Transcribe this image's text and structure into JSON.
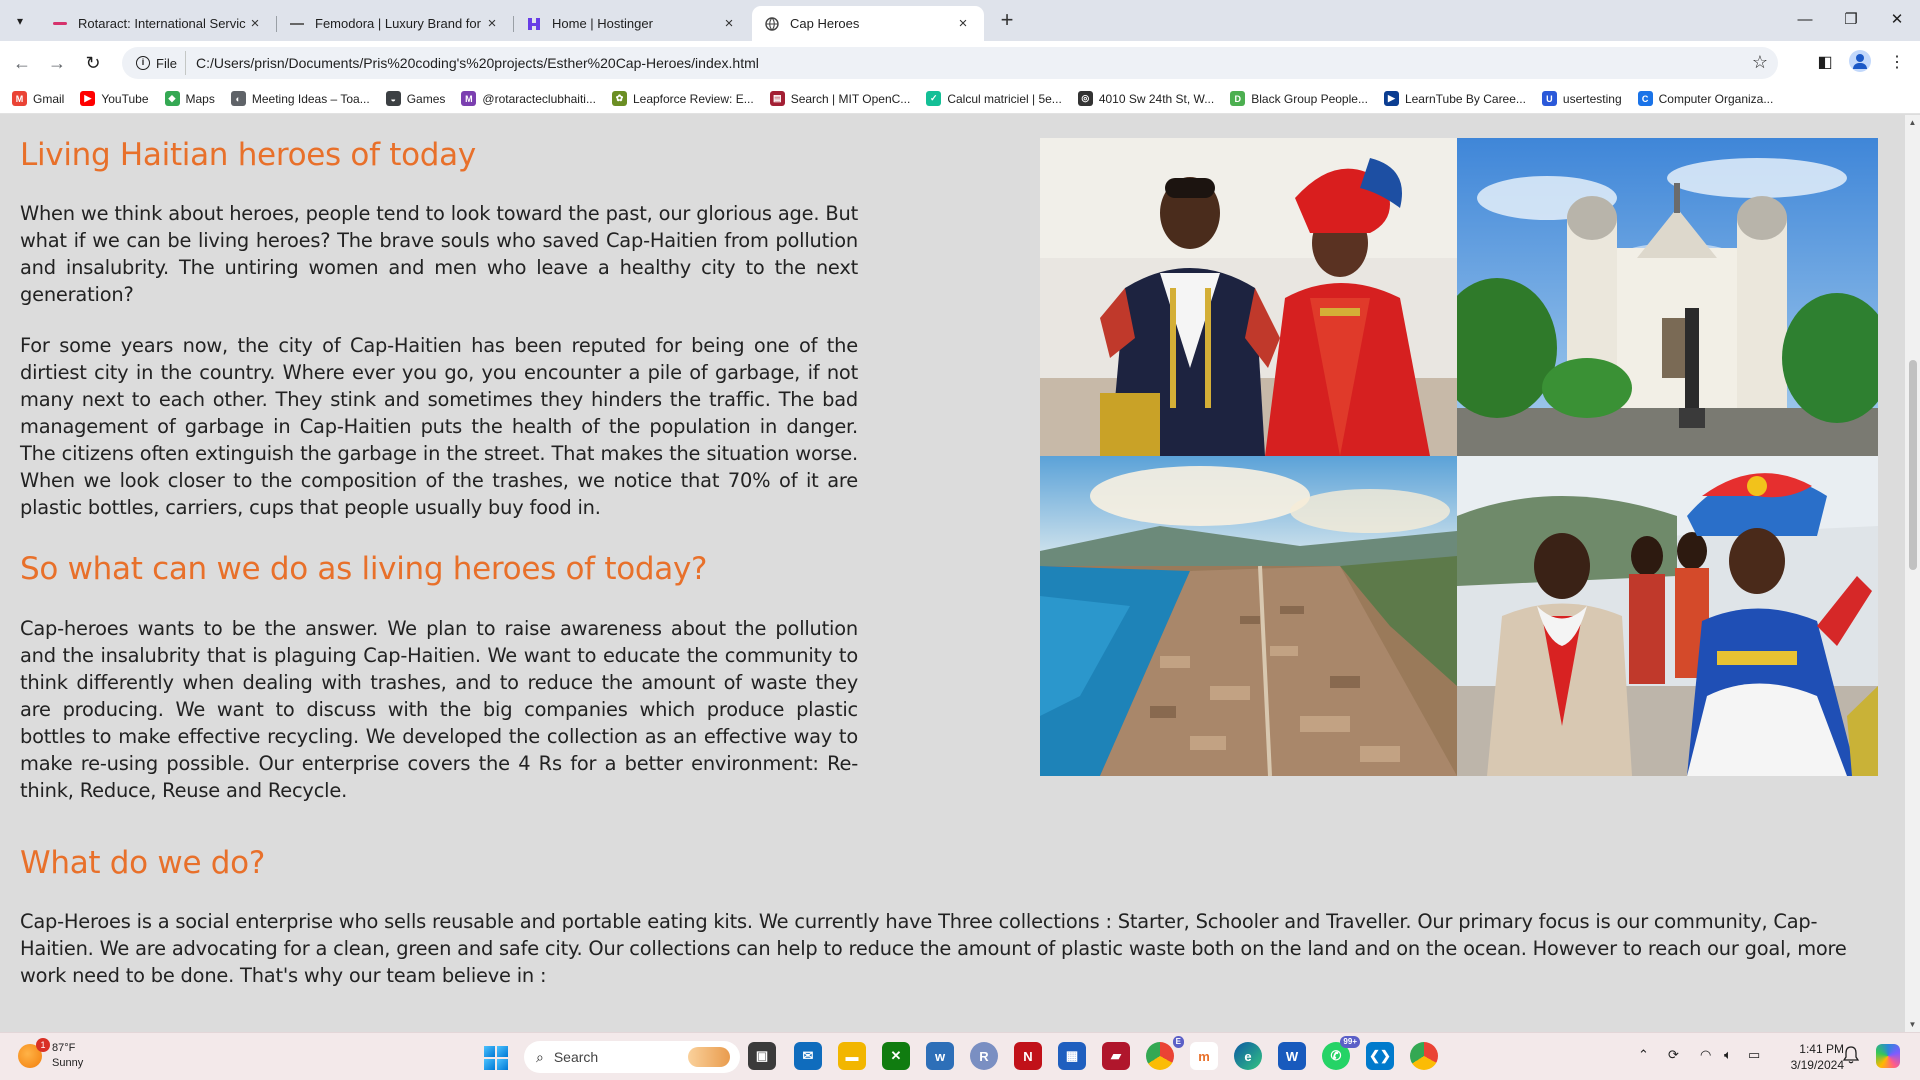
{
  "browser": {
    "tabs": [
      {
        "title": "Rotaract: International Service Cl",
        "icon": "rotaract-favicon"
      },
      {
        "title": "Femodora | Luxury Brand for Wo",
        "icon": "femodora-favicon"
      },
      {
        "title": "Home | Hostinger",
        "icon": "hostinger-favicon"
      },
      {
        "title": "Cap Heroes",
        "icon": "globe-favicon",
        "active": true
      }
    ],
    "omnibox": {
      "scheme_label": "File",
      "url": "C:/Users/prisn/Documents/Pris%20coding's%20projects/Esther%20Cap-Heroes/index.html"
    },
    "bookmarks": [
      {
        "label": "Gmail",
        "icon": "gmail-icon",
        "color": "#ea4335",
        "glyph": "M"
      },
      {
        "label": "YouTube",
        "icon": "youtube-icon",
        "color": "#ff0000",
        "glyph": "▶"
      },
      {
        "label": "Maps",
        "icon": "maps-icon",
        "color": "#34a853",
        "glyph": "◆"
      },
      {
        "label": "Meeting Ideas – Toa...",
        "icon": "globe-icon",
        "color": "#5f6368",
        "glyph": "◐"
      },
      {
        "label": "Games",
        "icon": "games-icon",
        "color": "#3c4043",
        "glyph": "◒"
      },
      {
        "label": "@rotaracteclubhaiti...",
        "icon": "rotaract-icon",
        "color": "#7b3fb0",
        "glyph": "M"
      },
      {
        "label": "Leapforce Review: E...",
        "icon": "leapforce-icon",
        "color": "#6b8e23",
        "glyph": "✿"
      },
      {
        "label": "Search | MIT OpenC...",
        "icon": "mit-icon",
        "color": "#a31f34",
        "glyph": "▤"
      },
      {
        "label": "Calcul matriciel | 5e...",
        "icon": "khan-icon",
        "color": "#14bf96",
        "glyph": "✓"
      },
      {
        "label": "4010 Sw 24th St, W...",
        "icon": "location-icon",
        "color": "#333333",
        "glyph": "◎"
      },
      {
        "label": "Black Group People...",
        "icon": "doc-icon",
        "color": "#4caf50",
        "glyph": "D"
      },
      {
        "label": "LearnTube By Caree...",
        "icon": "learntube-icon",
        "color": "#0b3d91",
        "glyph": "▶"
      },
      {
        "label": "usertesting",
        "icon": "usertesting-icon",
        "color": "#2b59d9",
        "glyph": "U"
      },
      {
        "label": "Computer Organiza...",
        "icon": "computer-org-icon",
        "color": "#1a73e8",
        "glyph": "C"
      }
    ]
  },
  "page": {
    "heading1": "Living Haitian heroes of today",
    "para1": "When we think about heroes, people tend to look toward the past, our glorious age. But what if we can be living heroes? The brave souls who saved Cap-Haitien from pollution and insalubrity. The untiring women and men who leave a healthy city to the next generation?",
    "para2": "For some years now, the city of Cap-Haitien has been reputed for being one of the dirtiest city in the country. Where ever you go, you encounter a pile of garbage, if not many next to each other. They stink and sometimes they hinders the traffic. The bad management of garbage in Cap-Haitien puts the health of the population in danger. The citizens often extinguish the garbage in the street. That makes the situation worse. When we look closer to the composition of the trashes, we notice that 70% of it are plastic bottles, carriers, cups that people usually buy food in.",
    "heading2": "So what can we do as living heroes of today?",
    "para3": "Cap-heroes wants to be the answer. We plan to raise awareness about the pollution and the insalubrity that is plaguing Cap-Haitien. We want to educate the community to think differently when dealing with trashes, and to reduce the amount of waste they are producing. We want to discuss with the big companies which produce plastic bottles to make effective recycling. We developed the collection as an effective way to make re-using possible. Our enterprise covers the 4 Rs for a better environment: Re-think, Reduce, Reuse and Recycle.",
    "heading3": "What do we do?",
    "para4": "Cap-Heroes is a social enterprise who sells reusable and portable eating kits. We currently have Three collections : Starter, Schooler and Traveller. Our primary focus is our community, Cap-Haitien. We are advocating for a clean, green and safe city. Our collections can help to reduce the amount of plastic waste both on the land and on the ocean. However to reach our goal, more work need to be done. That's why our team believe in :",
    "accent_color": "#e8702a",
    "gallery": [
      "couple-in-traditional-costume-photo",
      "cathedral-photo",
      "aerial-city-photo",
      "carnival-dancers-photo"
    ]
  },
  "taskbar": {
    "weather_temp": "87°F",
    "weather_desc": "Sunny",
    "weather_badge": "1",
    "search_placeholder": "Search",
    "time": "1:41 PM",
    "date": "3/19/2024",
    "whatsapp_badge": "99+",
    "chrome_badge": "E"
  }
}
